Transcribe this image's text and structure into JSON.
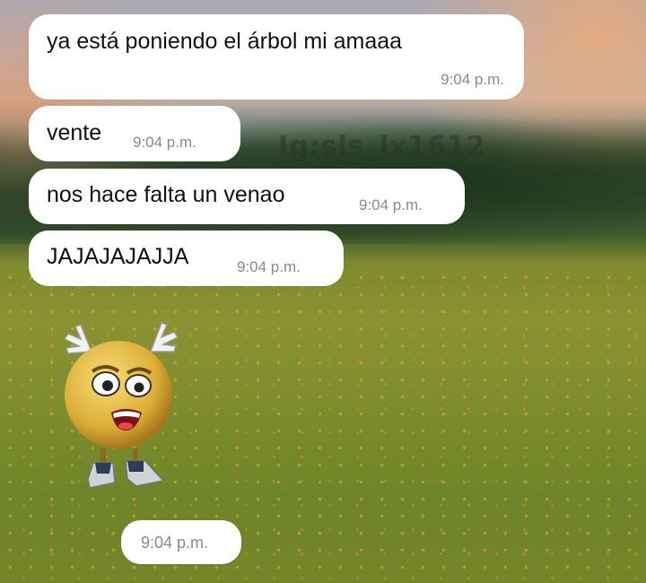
{
  "watermark": "Ig:sls_lx1612",
  "messages": [
    {
      "text": "ya está poniendo el árbol mi amaaa",
      "time": "9:04 p.m."
    },
    {
      "text": "vente",
      "time": "9:04 p.m."
    },
    {
      "text": "nos hace falta un venao",
      "time": "9:04 p.m."
    },
    {
      "text": "JAJAJAJAJJA",
      "time": "9:04 p.m."
    }
  ],
  "sticker": {
    "icon": "reindeer-emoji-sticker",
    "time": "9:04 p.m."
  },
  "colors": {
    "bubble": "#ffffff",
    "time_text": "#8a8a8a",
    "emoji_face": "#e8c24a"
  }
}
